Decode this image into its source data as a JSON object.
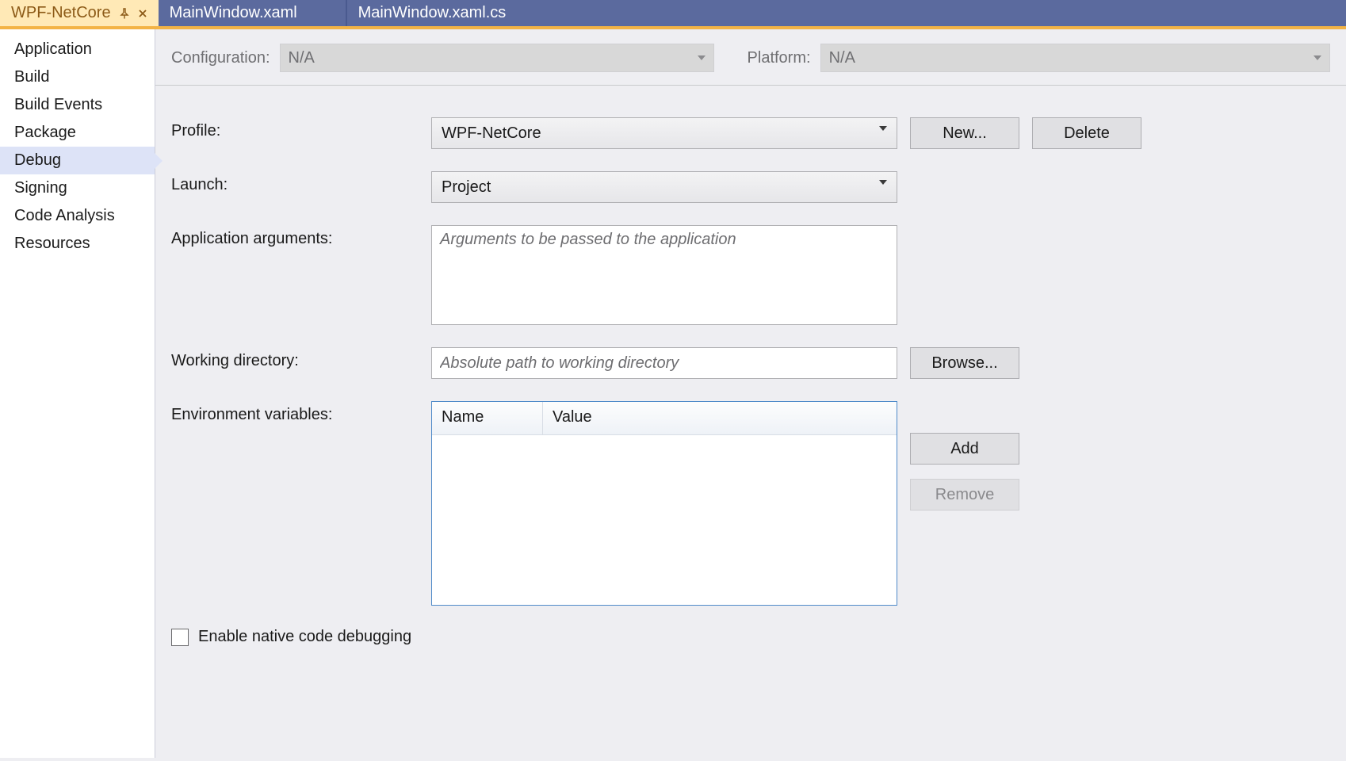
{
  "tabs": [
    {
      "label": "WPF-NetCore",
      "active": true
    },
    {
      "label": "MainWindow.xaml",
      "active": false
    },
    {
      "label": "MainWindow.xaml.cs",
      "active": false
    }
  ],
  "sidebar": {
    "items": [
      "Application",
      "Build",
      "Build Events",
      "Package",
      "Debug",
      "Signing",
      "Code Analysis",
      "Resources"
    ],
    "selected": "Debug"
  },
  "config": {
    "configuration_label": "Configuration:",
    "configuration_value": "N/A",
    "platform_label": "Platform:",
    "platform_value": "N/A"
  },
  "form": {
    "profile_label": "Profile:",
    "profile_value": "WPF-NetCore",
    "new_button": "New...",
    "delete_button": "Delete",
    "launch_label": "Launch:",
    "launch_value": "Project",
    "app_args_label": "Application arguments:",
    "app_args_placeholder": "Arguments to be passed to the application",
    "workdir_label": "Working directory:",
    "workdir_placeholder": "Absolute path to working directory",
    "browse_button": "Browse...",
    "env_label": "Environment variables:",
    "env_col_name": "Name",
    "env_col_value": "Value",
    "add_button": "Add",
    "remove_button": "Remove",
    "native_debug_label": "Enable native code debugging"
  }
}
